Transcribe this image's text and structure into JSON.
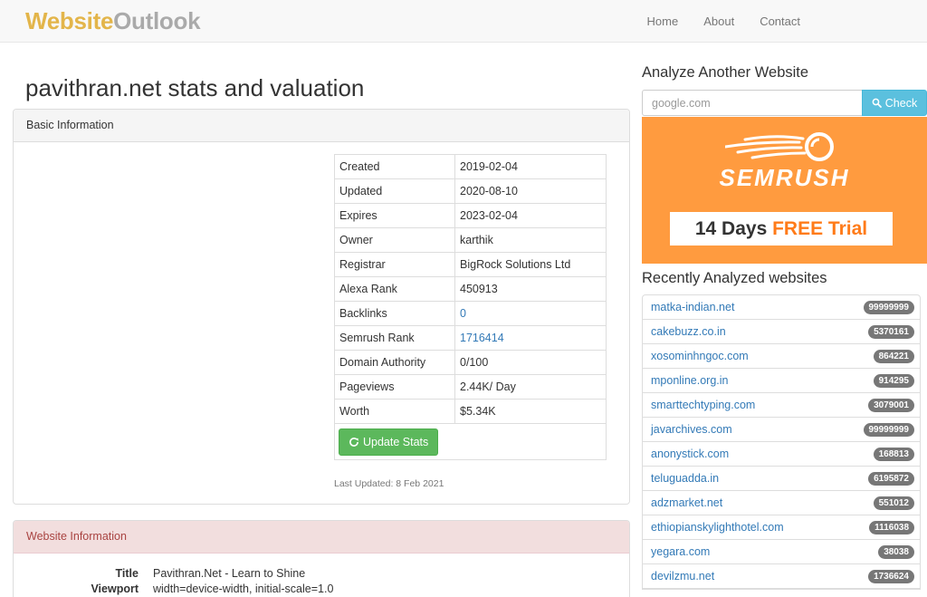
{
  "nav": {
    "brand_part1": "Website",
    "brand_part2": "Outlook",
    "links": [
      "Home",
      "About",
      "Contact"
    ]
  },
  "main": {
    "title": "pavithran.net stats and valuation",
    "basic_heading": "Basic Information",
    "rows": [
      {
        "label": "Created",
        "value": "2019-02-04"
      },
      {
        "label": "Updated",
        "value": "2020-08-10"
      },
      {
        "label": "Expires",
        "value": "2023-02-04"
      },
      {
        "label": "Owner",
        "value": "karthik"
      },
      {
        "label": "Registrar",
        "value": "BigRock Solutions Ltd"
      },
      {
        "label": "Alexa Rank",
        "value": "450913"
      },
      {
        "label": "Backlinks",
        "value": "0"
      },
      {
        "label": "Semrush Rank",
        "value": "1716414"
      },
      {
        "label": "Domain Authority",
        "value": "0/100"
      },
      {
        "label": "Pageviews",
        "value": "2.44K/ Day"
      },
      {
        "label": "Worth",
        "value": "$5.34K"
      }
    ],
    "update_button": "Update Stats",
    "last_updated": "Last Updated: 8 Feb 2021",
    "website_heading": "Website Information",
    "site_rows": [
      {
        "label": "Title",
        "value": "Pavithran.Net - Learn to Shine"
      },
      {
        "label": "Viewport",
        "value": "width=device-width, initial-scale=1.0"
      }
    ]
  },
  "sidebar": {
    "analyze_title": "Analyze Another Website",
    "search_placeholder": "google.com",
    "check_button": "Check",
    "ad": {
      "logo": "SEMRUSH",
      "trial_part1": "14 Days ",
      "trial_part2": "FREE Trial"
    },
    "recent_title": "Recently Analyzed websites",
    "recent": [
      {
        "site": "matka-indian.net",
        "rank": "99999999"
      },
      {
        "site": "cakebuzz.co.in",
        "rank": "5370161"
      },
      {
        "site": "xosominhngoc.com",
        "rank": "864221"
      },
      {
        "site": "mponline.org.in",
        "rank": "914295"
      },
      {
        "site": "smarttechtyping.com",
        "rank": "3079001"
      },
      {
        "site": "javarchives.com",
        "rank": "99999999"
      },
      {
        "site": "anonystick.com",
        "rank": "168813"
      },
      {
        "site": "teluguadda.in",
        "rank": "6195872"
      },
      {
        "site": "adzmarket.net",
        "rank": "551012"
      },
      {
        "site": "ethiopianskylighthotel.com",
        "rank": "1116038"
      },
      {
        "site": "yegara.com",
        "rank": "38038"
      },
      {
        "site": "devilzmu.net",
        "rank": "1736624"
      }
    ]
  }
}
